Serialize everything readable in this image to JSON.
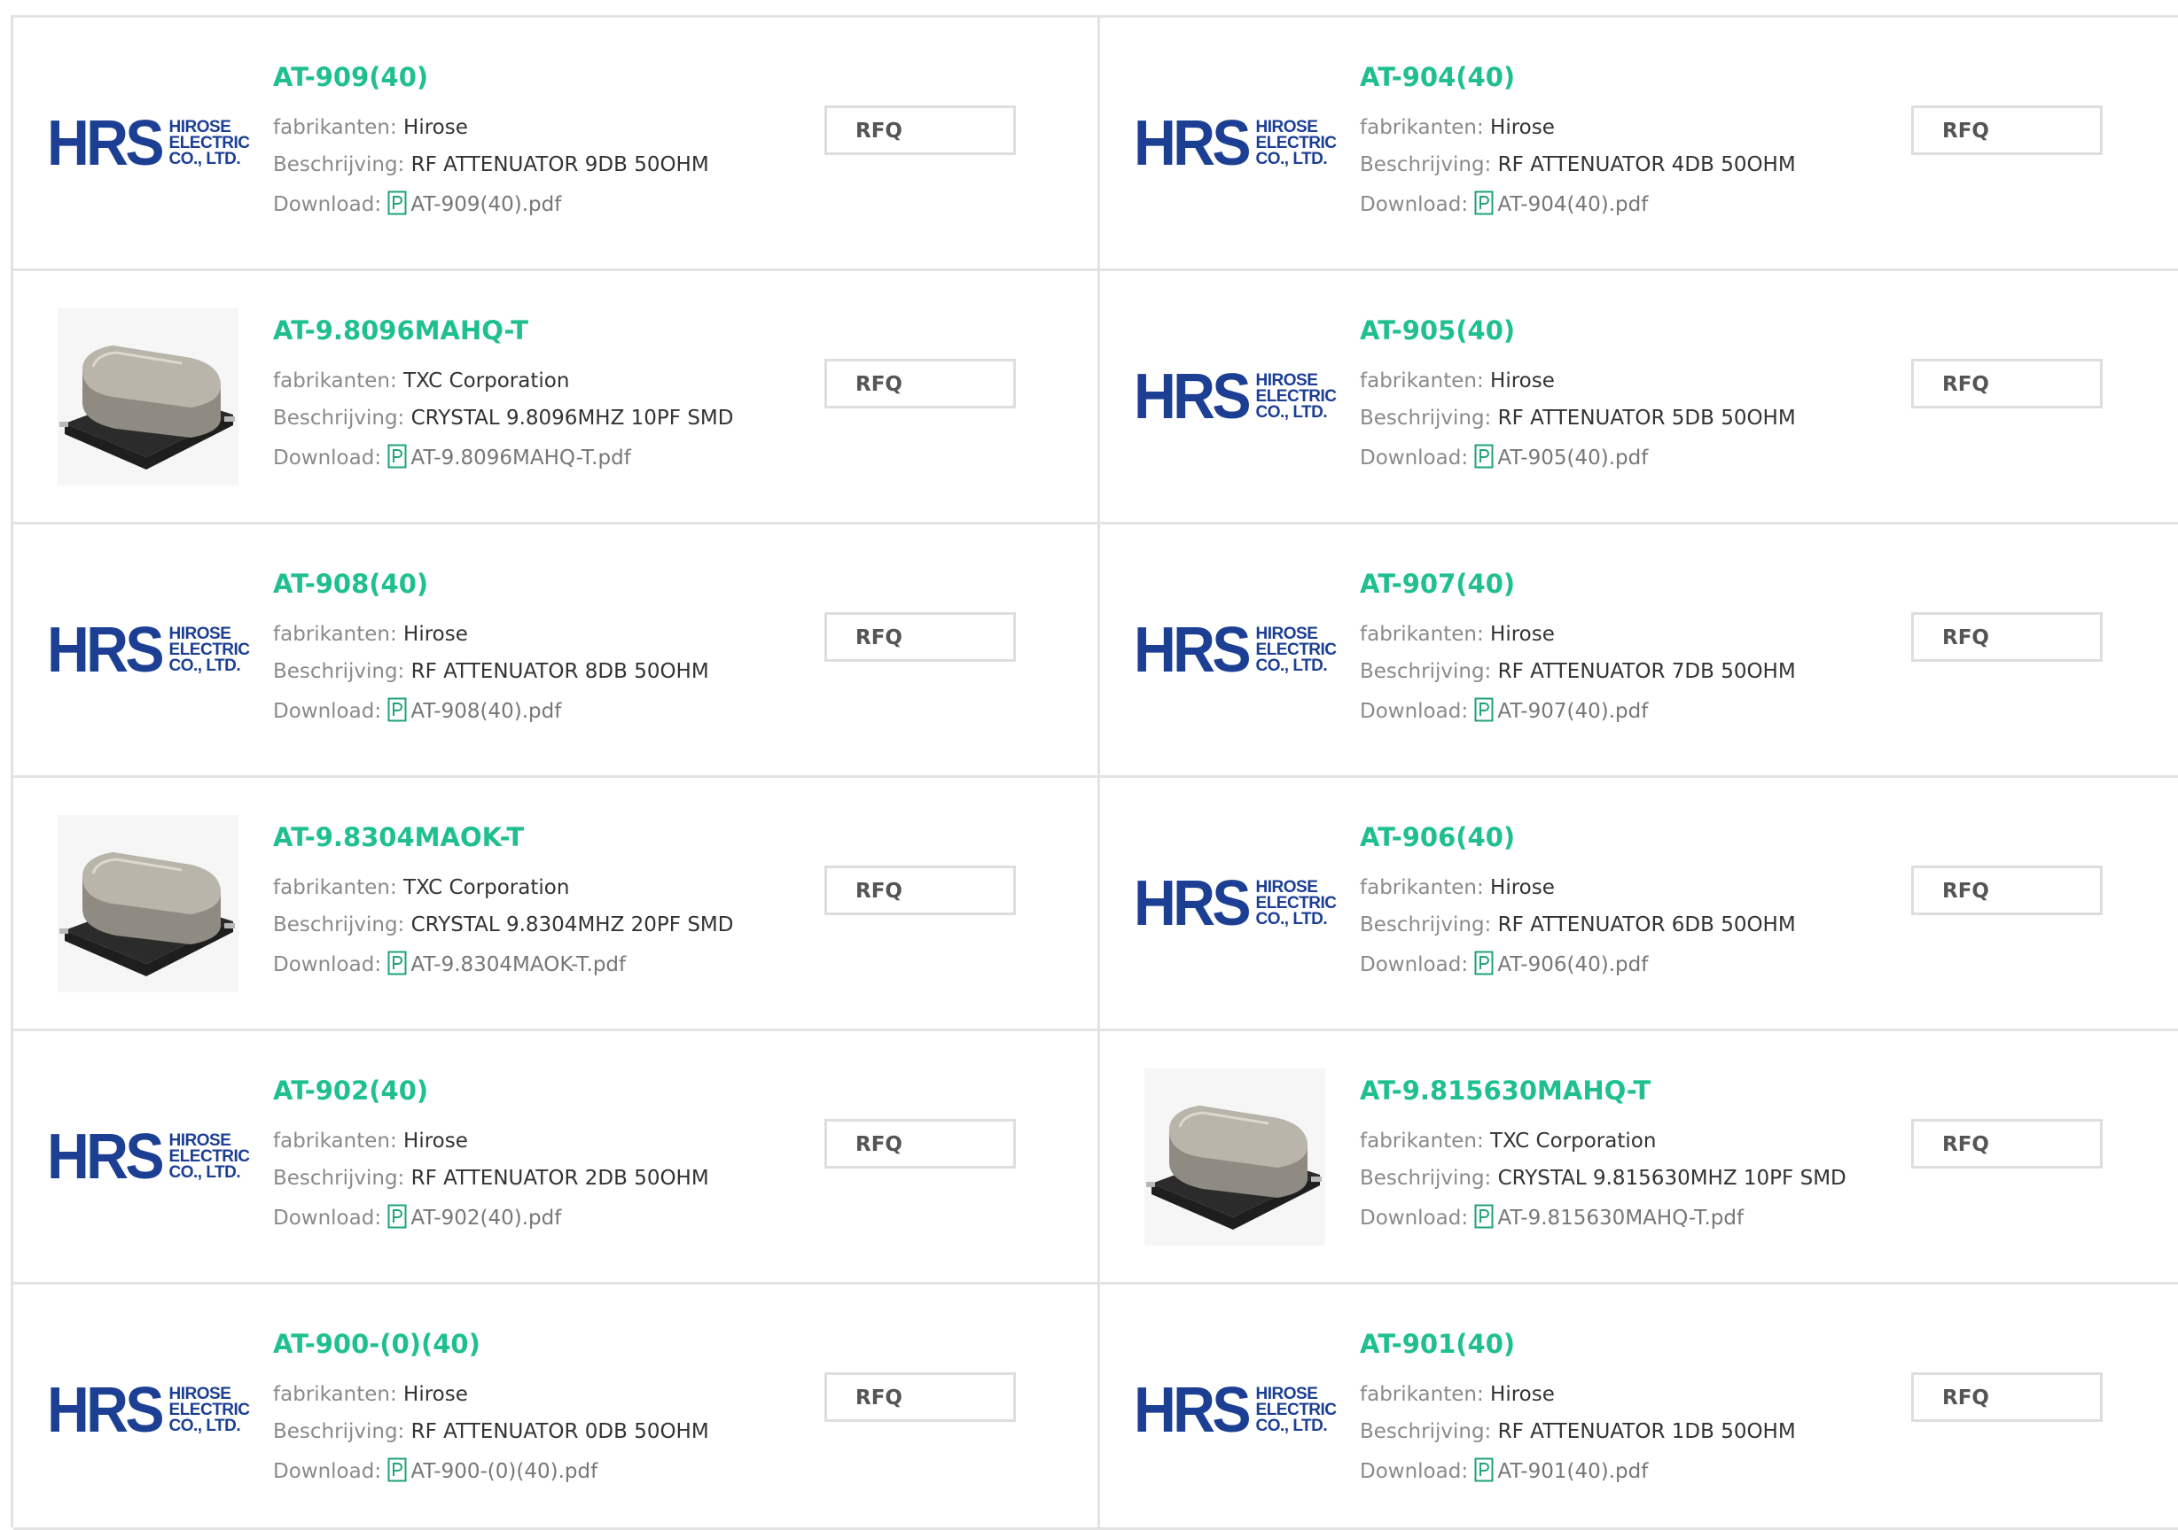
{
  "labels": {
    "manufacturer": "fabrikanten:",
    "description": "Beschrijving:",
    "download": "Download:",
    "rfq": "RFQ"
  },
  "logo_text": {
    "mark": "HRS",
    "line1": "HIROSE",
    "line2": "ELECTRIC",
    "line3": "CO., LTD."
  },
  "colors": {
    "title": "#1fbf8f",
    "logo": "#1c3f94",
    "border": "#e3e3e3"
  },
  "products": [
    {
      "part": "AT-909(40)",
      "manufacturer": "Hirose",
      "description": "RF ATTENUATOR 9DB 50OHM",
      "pdf": "AT-909(40).pdf",
      "image": "hirose-logo"
    },
    {
      "part": "AT-904(40)",
      "manufacturer": "Hirose",
      "description": "RF ATTENUATOR 4DB 50OHM",
      "pdf": "AT-904(40).pdf",
      "image": "hirose-logo"
    },
    {
      "part": "AT-9.8096MAHQ-T",
      "manufacturer": "TXC Corporation",
      "description": "CRYSTAL 9.8096MHZ 10PF SMD",
      "pdf": "AT-9.8096MAHQ-T.pdf",
      "image": "crystal-photo"
    },
    {
      "part": "AT-905(40)",
      "manufacturer": "Hirose",
      "description": "RF ATTENUATOR 5DB 50OHM",
      "pdf": "AT-905(40).pdf",
      "image": "hirose-logo"
    },
    {
      "part": "AT-908(40)",
      "manufacturer": "Hirose",
      "description": "RF ATTENUATOR 8DB 50OHM",
      "pdf": "AT-908(40).pdf",
      "image": "hirose-logo"
    },
    {
      "part": "AT-907(40)",
      "manufacturer": "Hirose",
      "description": "RF ATTENUATOR 7DB 50OHM",
      "pdf": "AT-907(40).pdf",
      "image": "hirose-logo"
    },
    {
      "part": "AT-9.8304MAOK-T",
      "manufacturer": "TXC Corporation",
      "description": "CRYSTAL 9.8304MHZ 20PF SMD",
      "pdf": "AT-9.8304MAOK-T.pdf",
      "image": "crystal-photo"
    },
    {
      "part": "AT-906(40)",
      "manufacturer": "Hirose",
      "description": "RF ATTENUATOR 6DB 50OHM",
      "pdf": "AT-906(40).pdf",
      "image": "hirose-logo"
    },
    {
      "part": "AT-902(40)",
      "manufacturer": "Hirose",
      "description": "RF ATTENUATOR 2DB 50OHM",
      "pdf": "AT-902(40).pdf",
      "image": "hirose-logo"
    },
    {
      "part": "AT-9.815630MAHQ-T",
      "manufacturer": "TXC Corporation",
      "description": "CRYSTAL 9.815630MHZ 10PF SMD",
      "pdf": "AT-9.815630MAHQ-T.pdf",
      "image": "crystal-photo"
    },
    {
      "part": "AT-900-(0)(40)",
      "manufacturer": "Hirose",
      "description": "RF ATTENUATOR 0DB 50OHM",
      "pdf": "AT-900-(0)(40).pdf",
      "image": "hirose-logo"
    },
    {
      "part": "AT-901(40)",
      "manufacturer": "Hirose",
      "description": "RF ATTENUATOR 1DB 50OHM",
      "pdf": "AT-901(40).pdf",
      "image": "hirose-logo"
    }
  ]
}
